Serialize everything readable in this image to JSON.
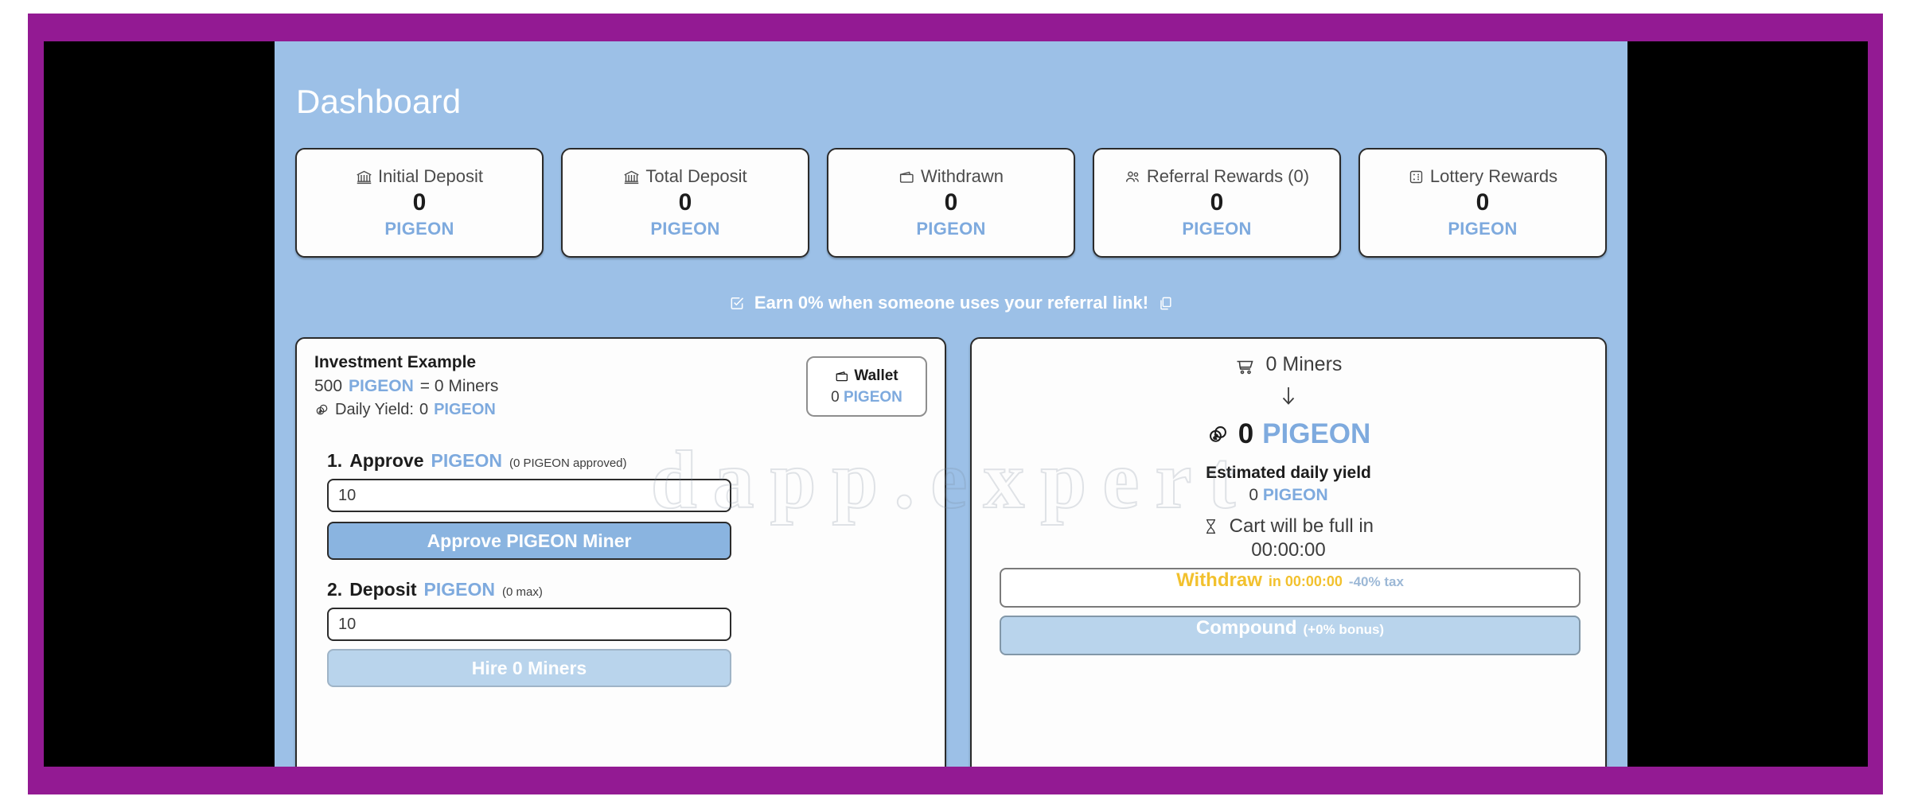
{
  "theme": {
    "frame_purple": "#931a93",
    "stage_black": "#000000",
    "panel_blue": "#9cc0e7",
    "token_blue": "#7eaade",
    "button_blue": "#8ab4e0",
    "button_disabled_blue": "#b9d4ec",
    "withdraw_yellow": "#f2c12e"
  },
  "watermark": {
    "text": "dapp.expert"
  },
  "header": {
    "title": "Dashboard"
  },
  "stats": [
    {
      "icon": "bank-icon",
      "label": "Initial Deposit",
      "value": "0",
      "token": "PIGEON"
    },
    {
      "icon": "bank-icon",
      "label": "Total Deposit",
      "value": "0",
      "token": "PIGEON"
    },
    {
      "icon": "wallet-icon",
      "label": "Withdrawn",
      "value": "0",
      "token": "PIGEON"
    },
    {
      "icon": "users-icon",
      "label": "Referral Rewards (0)",
      "value": "0",
      "token": "PIGEON"
    },
    {
      "icon": "ticket-icon",
      "label": "Lottery Rewards",
      "value": "0",
      "token": "PIGEON"
    }
  ],
  "referral": {
    "icon": "check-square-icon",
    "text": "Earn 0% when someone uses your referral link!",
    "copy_icon": "copy-icon"
  },
  "left_panel": {
    "investment_title": "Investment Example",
    "example_amount": "500",
    "example_token": "PIGEON",
    "example_equals": "= 0 Miners",
    "yield_icon": "coins-icon",
    "yield_label": "Daily Yield:",
    "yield_value": "0",
    "yield_token": "PIGEON",
    "wallet": {
      "icon": "wallet-icon",
      "label": "Wallet",
      "value": "0",
      "token": "PIGEON"
    },
    "approve": {
      "step": "1.",
      "action": "Approve",
      "token": "PIGEON",
      "note": "(0 PIGEON approved)",
      "input_value": "10",
      "input_placeholder": "10",
      "button_label": "Approve PIGEON Miner"
    },
    "deposit": {
      "step": "2.",
      "action": "Deposit",
      "token": "PIGEON",
      "note": "(0 max)",
      "input_value": "10",
      "input_placeholder": "10",
      "button_label": "Hire 0 Miners"
    }
  },
  "right_panel": {
    "miners_icon": "cart-icon",
    "miners_text": "0 Miners",
    "arrow_icon": "arrow-down-icon",
    "amount_icon": "coins-icon",
    "amount_value": "0",
    "amount_token": "PIGEON",
    "yield_title": "Estimated daily yield",
    "yield_value": "0",
    "yield_token": "PIGEON",
    "cart_full_icon": "hourglass-icon",
    "cart_full_label": "Cart will be full in",
    "cart_full_time": "00:00:00",
    "withdraw": {
      "main": "Withdraw",
      "in_label": "in 00:00:00",
      "tax_label": "-40% tax"
    },
    "compound": {
      "main": "Compound",
      "bonus_label": "(+0% bonus)"
    }
  }
}
